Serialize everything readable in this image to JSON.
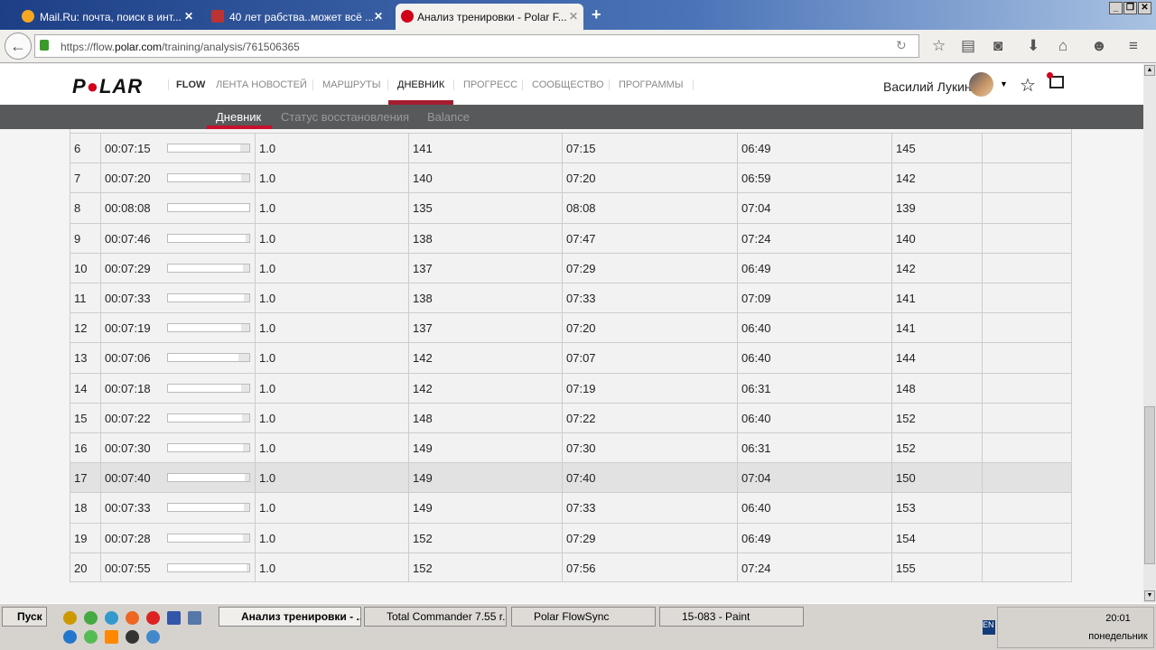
{
  "browser": {
    "tabs": [
      {
        "label": "Mail.Ru: почта, поиск в инт..."
      },
      {
        "label": "40 лет рабства..может всё ..."
      },
      {
        "label": "Анализ тренировки - Polar F..."
      }
    ],
    "url_prefix": "https://flow.",
    "url_domain": "polar.com",
    "url_path": "/training/analysis/761506365"
  },
  "site": {
    "logo": "POLAR",
    "flow": "FLOW",
    "nav": [
      "ЛЕНТА НОВОСТЕЙ",
      "МАРШРУТЫ",
      "ДНЕВНИК",
      "ПРОГРЕСС",
      "СООБЩЕСТВО",
      "ПРОГРАММЫ"
    ],
    "user": "Василий Лукин",
    "subnav": [
      "Дневник",
      "Статус восстановления",
      "Balance"
    ]
  },
  "laps": [
    {
      "n": "6",
      "time": "00:07:15",
      "bar": 0.89,
      "dist": "1.0",
      "hr": "141",
      "pace": "07:15",
      "best": "06:49",
      "max": "145"
    },
    {
      "n": "7",
      "time": "00:07:20",
      "bar": 0.9,
      "dist": "1.0",
      "hr": "140",
      "pace": "07:20",
      "best": "06:59",
      "max": "142"
    },
    {
      "n": "8",
      "time": "00:08:08",
      "bar": 1.0,
      "dist": "1.0",
      "hr": "135",
      "pace": "08:08",
      "best": "07:04",
      "max": "139"
    },
    {
      "n": "9",
      "time": "00:07:46",
      "bar": 0.95,
      "dist": "1.0",
      "hr": "138",
      "pace": "07:47",
      "best": "07:24",
      "max": "140"
    },
    {
      "n": "10",
      "time": "00:07:29",
      "bar": 0.92,
      "dist": "1.0",
      "hr": "137",
      "pace": "07:29",
      "best": "06:49",
      "max": "142"
    },
    {
      "n": "11",
      "time": "00:07:33",
      "bar": 0.93,
      "dist": "1.0",
      "hr": "138",
      "pace": "07:33",
      "best": "07:09",
      "max": "141"
    },
    {
      "n": "12",
      "time": "00:07:19",
      "bar": 0.9,
      "dist": "1.0",
      "hr": "137",
      "pace": "07:20",
      "best": "06:40",
      "max": "141"
    },
    {
      "n": "13",
      "time": "00:07:06",
      "bar": 0.87,
      "dist": "1.0",
      "hr": "142",
      "pace": "07:07",
      "best": "06:40",
      "max": "144"
    },
    {
      "n": "14",
      "time": "00:07:18",
      "bar": 0.9,
      "dist": "1.0",
      "hr": "142",
      "pace": "07:19",
      "best": "06:31",
      "max": "148"
    },
    {
      "n": "15",
      "time": "00:07:22",
      "bar": 0.91,
      "dist": "1.0",
      "hr": "148",
      "pace": "07:22",
      "best": "06:40",
      "max": "152"
    },
    {
      "n": "16",
      "time": "00:07:30",
      "bar": 0.92,
      "dist": "1.0",
      "hr": "149",
      "pace": "07:30",
      "best": "06:31",
      "max": "152"
    },
    {
      "n": "17",
      "time": "00:07:40",
      "bar": 0.94,
      "dist": "1.0",
      "hr": "149",
      "pace": "07:40",
      "best": "07:04",
      "max": "150",
      "highlight": true
    },
    {
      "n": "18",
      "time": "00:07:33",
      "bar": 0.93,
      "dist": "1.0",
      "hr": "149",
      "pace": "07:33",
      "best": "06:40",
      "max": "153"
    },
    {
      "n": "19",
      "time": "00:07:28",
      "bar": 0.92,
      "dist": "1.0",
      "hr": "152",
      "pace": "07:29",
      "best": "06:49",
      "max": "154"
    },
    {
      "n": "20",
      "time": "00:07:55",
      "bar": 0.97,
      "dist": "1.0",
      "hr": "152",
      "pace": "07:56",
      "best": "07:24",
      "max": "155"
    }
  ],
  "taskbar": {
    "start": "Пуск",
    "tasks": [
      "Анализ тренировки - ...",
      "Total Commander 7.55 r...",
      "Polar FlowSync",
      "15-083 - Paint"
    ],
    "lang": "EN",
    "time": "20:01",
    "day": "понедельник"
  }
}
